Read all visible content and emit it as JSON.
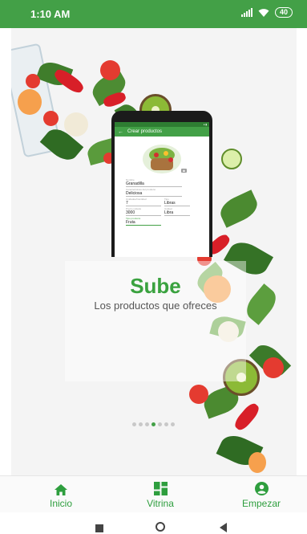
{
  "status_bar": {
    "time": "1:10 AM",
    "battery": "40",
    "icons": [
      "signal-icon",
      "wifi-icon",
      "battery-icon"
    ]
  },
  "hero": {
    "title": "Sube",
    "subtitle": "Los productos que ofreces",
    "carousel": {
      "total": 7,
      "active_index": 3
    }
  },
  "phone_preview": {
    "app_bar_title": "Crear productos",
    "fields": [
      {
        "label": "Nombre",
        "value": "Granadilla"
      },
      {
        "label": "Caracteristicas del producto",
        "value": "Deliciosa"
      },
      {
        "label": "Unidades/Cantidad",
        "value": "7"
      },
      {
        "label": "Tipo",
        "value": "Libras"
      },
      {
        "label": "Precio unitario",
        "value": "3000"
      },
      {
        "label": "Unidad",
        "value": "Libra"
      },
      {
        "label": "Tipo producto",
        "value": "Fruta"
      }
    ]
  },
  "bottom_nav": {
    "items": [
      {
        "label": "Inicio",
        "icon": "home-icon"
      },
      {
        "label": "Vitrina",
        "icon": "dashboard-icon"
      },
      {
        "label": "Empezar",
        "icon": "account-circle-icon"
      }
    ]
  },
  "android_nav": [
    "recent-apps-icon",
    "home-circle-icon",
    "back-icon"
  ],
  "colors": {
    "accent": "#43a047",
    "status_bar": "#43a047",
    "title": "#3aa23f"
  }
}
